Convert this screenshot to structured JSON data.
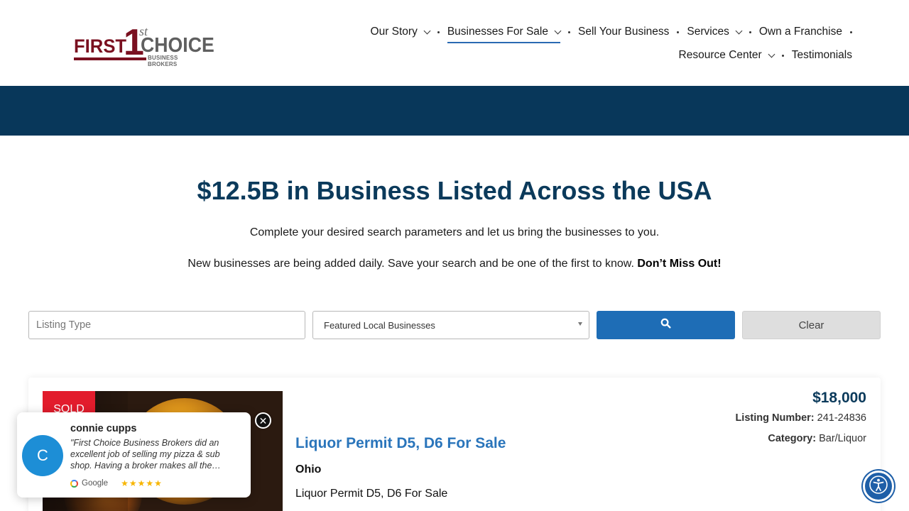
{
  "logo": {
    "word_first": "FIRST",
    "numeral": "1",
    "superscript": "st",
    "word_choice": "CHOICE",
    "tagline": "BUSINESS BROKERS",
    "brand_color": "#7a1020"
  },
  "nav": {
    "row1": [
      {
        "label": "Our Story",
        "dropdown": true
      },
      {
        "label": "Businesses For Sale",
        "dropdown": true,
        "active": true
      },
      {
        "label": "Sell Your Business",
        "dropdown": false
      },
      {
        "label": "Services",
        "dropdown": true
      },
      {
        "label": "Own a Franchise",
        "dropdown": false
      }
    ],
    "row2": [
      {
        "label": "Resource Center",
        "dropdown": true
      },
      {
        "label": "Testimonials",
        "dropdown": false
      }
    ]
  },
  "hero": {
    "band_color": "#08375a",
    "headline": "$12.5B in Business Listed Across the USA",
    "lead": "Complete your desired search parameters and let us bring the businesses to you.",
    "lead2_text": "New businesses are being added daily. Save your search and be one of the first to know.",
    "lead2_bold": "Don’t Miss Out!"
  },
  "search": {
    "listing_type_placeholder": "Listing Type",
    "filter_selected": "Featured Local Businesses",
    "search_icon": "search-icon",
    "clear_label": "Clear",
    "button_color": "#1e6db6"
  },
  "listing": {
    "badge": "SOLD",
    "price": "$18,000",
    "listing_number_label": "Listing Number:",
    "listing_number": "241-24836",
    "category_label": "Category:",
    "category": "Bar/Liquor",
    "title": "Liquor Permit D5, D6 For Sale",
    "state": "Ohio",
    "description": "Liquor Permit D5, D6 For Sale"
  },
  "review": {
    "avatar_letter": "C",
    "name": "connie cupps",
    "text": "\"First Choice Business Brokers did an excellent job of selling my pizza & sub shop. Having a broker makes all the…",
    "source": "Google",
    "stars": "★★★★★",
    "close_symbol": "✕"
  },
  "accessibility": {
    "icon": "accessibility-icon"
  }
}
